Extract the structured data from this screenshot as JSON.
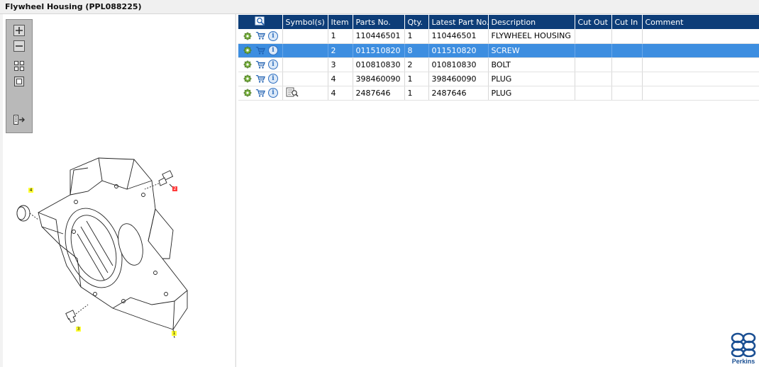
{
  "window": {
    "title": "Flywheel Housing (PPL088225)"
  },
  "toolbox": {
    "tools": [
      "zoom-in-icon",
      "zoom-out-icon",
      "fit-page-icon",
      "actual-size-icon",
      "export-list-icon"
    ]
  },
  "callouts": [
    {
      "label": "4",
      "color": "#ffff33"
    },
    {
      "label": "2",
      "color": "#ff3b3b"
    },
    {
      "label": "3",
      "color": "#ffff33"
    },
    {
      "label": "1",
      "color": "#ffff33"
    }
  ],
  "table": {
    "columns": [
      "",
      "Symbol(s)",
      "Item",
      "Parts No.",
      "Qty.",
      "Latest Part No.",
      "Description",
      "Cut Out",
      "Cut In",
      "Comment"
    ],
    "rows": [
      {
        "symbol": "",
        "item": "1",
        "part_no": "110446501",
        "qty": "1",
        "latest_part_no": "110446501",
        "description": "FLYWHEEL HOUSING",
        "cut_out": "",
        "cut_in": "",
        "comment": "",
        "selected": false
      },
      {
        "symbol": "",
        "item": "2",
        "part_no": "011510820",
        "qty": "8",
        "latest_part_no": "011510820",
        "description": "SCREW",
        "cut_out": "",
        "cut_in": "",
        "comment": "",
        "selected": true
      },
      {
        "symbol": "",
        "item": "3",
        "part_no": "010810830",
        "qty": "2",
        "latest_part_no": "010810830",
        "description": "BOLT",
        "cut_out": "",
        "cut_in": "",
        "comment": "",
        "selected": false
      },
      {
        "symbol": "",
        "item": "4",
        "part_no": "398460090",
        "qty": "1",
        "latest_part_no": "398460090",
        "description": "PLUG",
        "cut_out": "",
        "cut_in": "",
        "comment": "",
        "selected": false
      },
      {
        "symbol": "note-icon",
        "item": "4",
        "part_no": "2487646",
        "qty": "1",
        "latest_part_no": "2487646",
        "description": "PLUG",
        "cut_out": "",
        "cut_in": "",
        "comment": "",
        "selected": false
      }
    ]
  },
  "brand": {
    "name": "Perkins",
    "color": "#1a4f93"
  },
  "colors": {
    "header": "#0d3d78",
    "selected_row": "#3d8ee0"
  }
}
